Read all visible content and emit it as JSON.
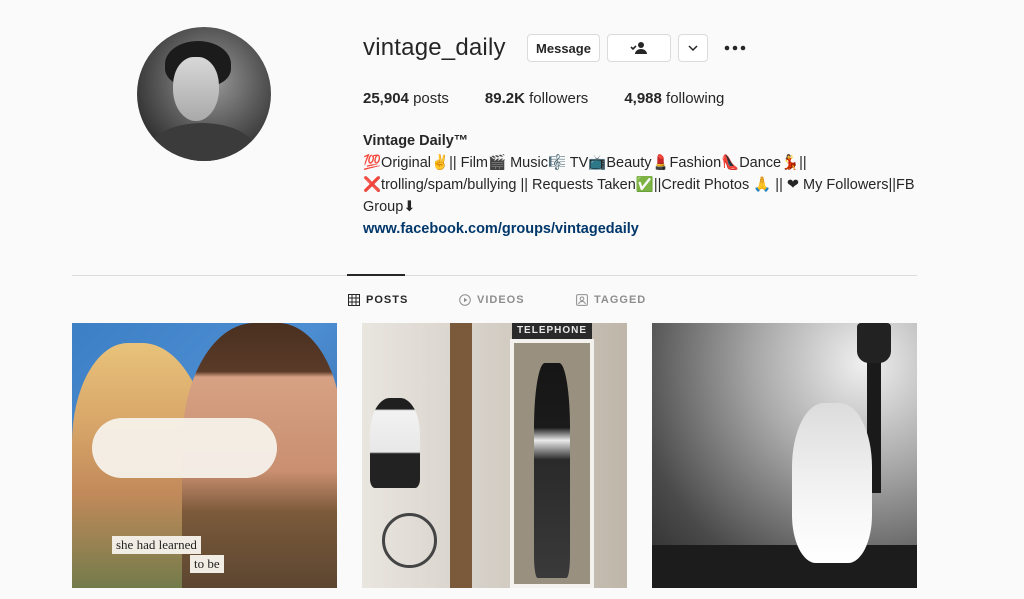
{
  "profile": {
    "username": "vintage_daily",
    "avatar_alt": "avatar",
    "buttons": {
      "message": "Message"
    },
    "stats": {
      "posts_count": "25,904",
      "posts_label": "posts",
      "followers_count": "89.2K",
      "followers_label": "followers",
      "following_count": "4,988",
      "following_label": "following"
    },
    "bio": {
      "name": "Vintage Daily™",
      "line1": "💯Original✌️|| Film🎬 Music🎼 TV📺Beauty💄Fashion👠Dance💃||",
      "line2": "❌trolling/spam/bullying || Requests Taken✅||Credit Photos 🙏 || ❤ My Followers||FB",
      "line3": "Group⬇",
      "link": "www.facebook.com/groups/vintagedaily"
    }
  },
  "tabs": [
    {
      "label": "POSTS",
      "icon": "grid-icon",
      "active": true
    },
    {
      "label": "VIDEOS",
      "icon": "play-icon",
      "active": false
    },
    {
      "label": "TAGGED",
      "icon": "tag-icon",
      "active": false
    }
  ],
  "posts": [
    {
      "captions": [
        "she had learned",
        "to be"
      ]
    },
    {
      "sign": "TELEPHONE"
    },
    {}
  ],
  "colors": {
    "background": "#fafafa",
    "text": "#262626",
    "muted": "#8e8e8e",
    "border": "#dbdbdb",
    "link": "#00376b"
  }
}
